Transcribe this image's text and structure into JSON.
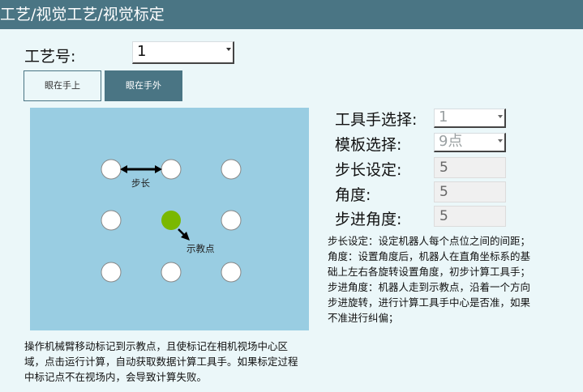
{
  "window": {
    "title": "工艺/视觉工艺/视觉标定"
  },
  "process": {
    "label": "工艺号:",
    "value": "1"
  },
  "buttons": {
    "hand_in_eye": "眼在手上",
    "hand_out_eye": "眼在手外"
  },
  "diagram": {
    "step_label": "步长",
    "teach_label": "示教点"
  },
  "settings": {
    "tool_label": "工具手选择:",
    "tool_value": "1",
    "template_label": "模板选择:",
    "template_value": "9点",
    "step_label": "步长设定:",
    "step_value": "5",
    "angle_label": "角度:",
    "angle_value": "5",
    "step_angle_label": "步进角度:",
    "step_angle_value": "5"
  },
  "notes": {
    "line1": "步长设定：设定机器人每个点位之间的间距；",
    "line2": "角度：设置角度后，机器人在直角坐标系的基",
    "line3": "础上左右各旋转设置角度，初步计算工具手；",
    "line4": "步进角度：机器人走到示教点，沿着一个方向",
    "line5": "步进旋转，进行计算工具手中心是否准，如果",
    "line6": "不准进行纠偏；"
  },
  "instructions": {
    "line1": "操作机械臂移动标记到示教点，且使标记在相机视场中心区",
    "line2": "域，点击运行计算，自动获取数据计算工具手。如果标定过程",
    "line3": "中标记点不在视场内，会导致计算失败。"
  },
  "colors": {
    "titlebar": "#4a7584",
    "background": "#ebf7f9",
    "panel": "#99cde2",
    "teach_point": "#7ab800"
  }
}
